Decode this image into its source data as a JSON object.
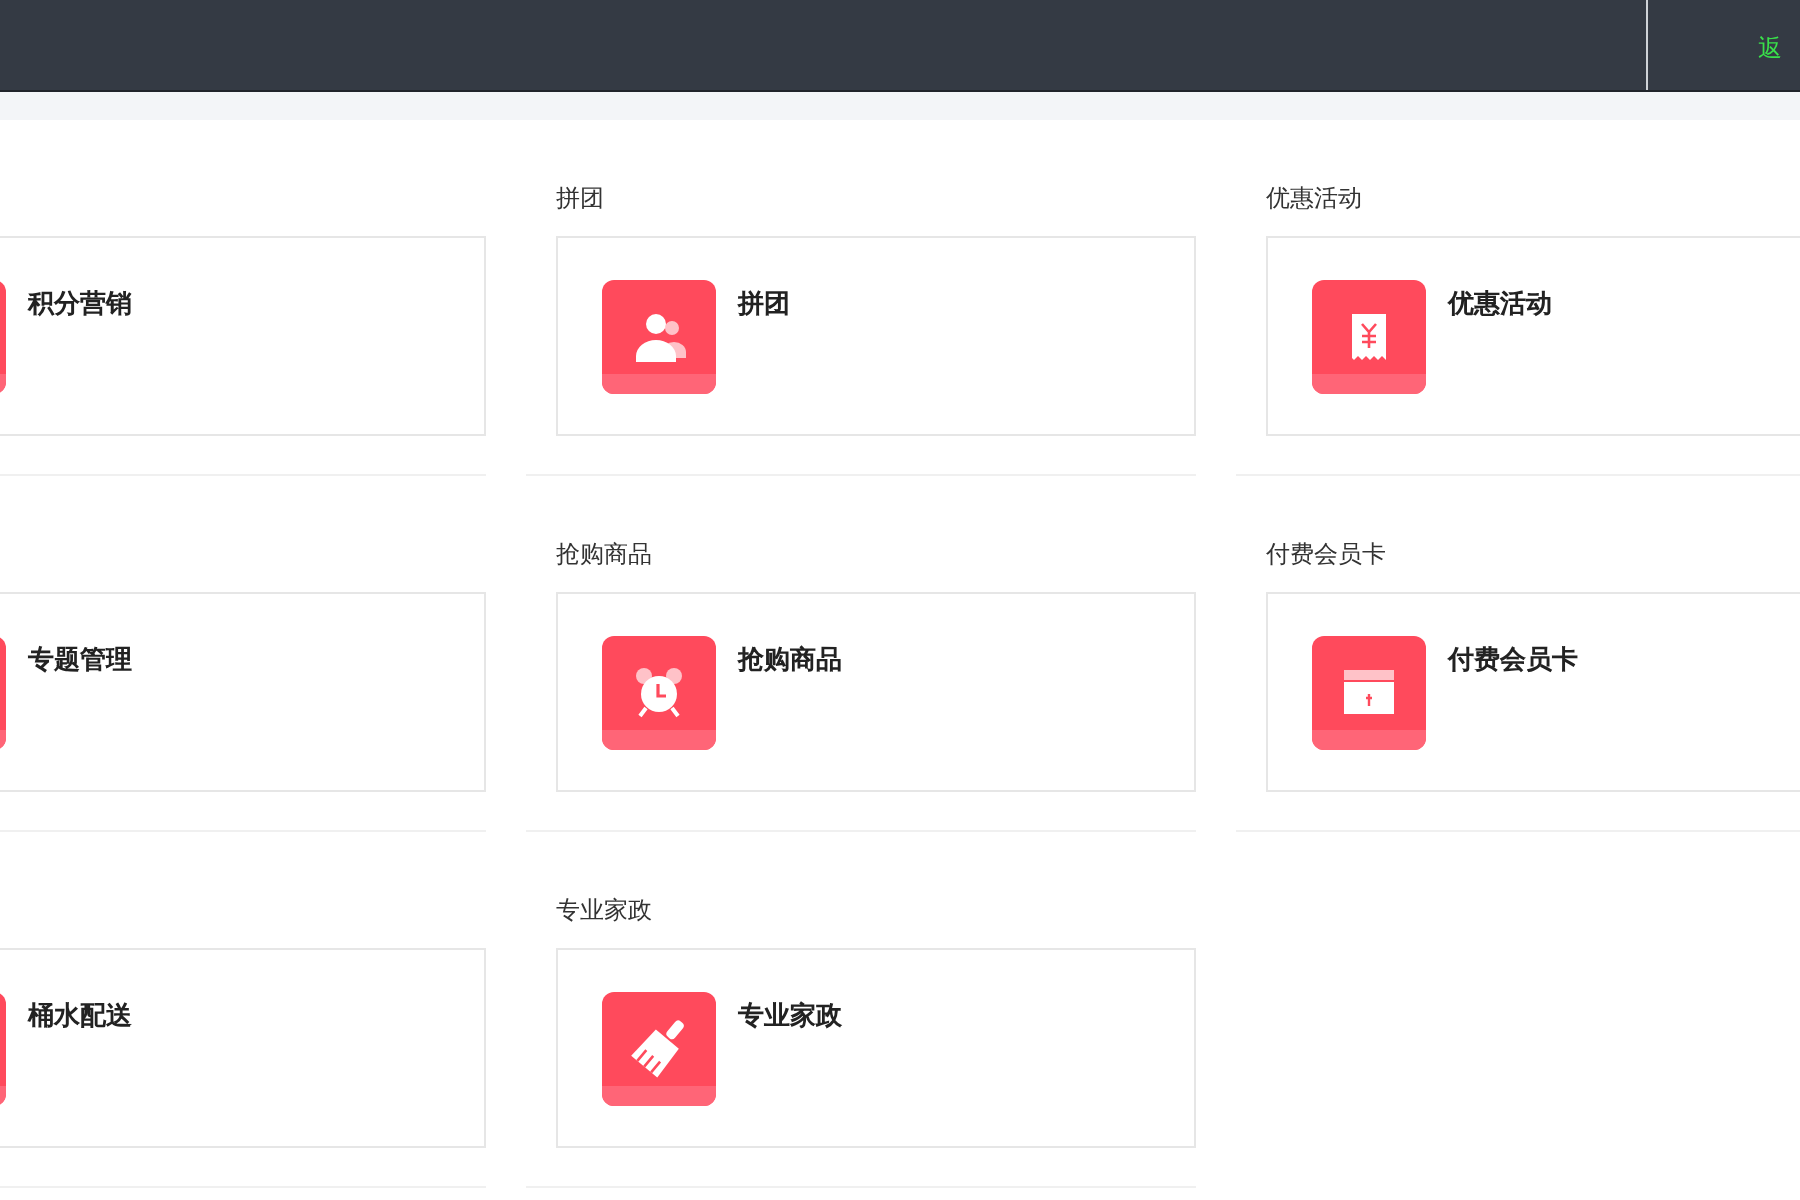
{
  "top_bar": {
    "back_link": "返"
  },
  "sections": [
    {
      "card_title": "积分营销"
    },
    {
      "title": "拼团",
      "card_title": "拼团",
      "kind": "people"
    },
    {
      "title": "优惠活动",
      "card_title": "优惠活动",
      "kind": "receipt"
    },
    {
      "card_title": "专题管理"
    },
    {
      "title": "抢购商品",
      "card_title": "抢购商品",
      "kind": "alarm"
    },
    {
      "title": "付费会员卡",
      "card_title": "付费会员卡",
      "kind": "card"
    },
    {
      "card_title": "桶水配送"
    },
    {
      "title": "专业家政",
      "card_title": "专业家政",
      "kind": "brush"
    }
  ]
}
